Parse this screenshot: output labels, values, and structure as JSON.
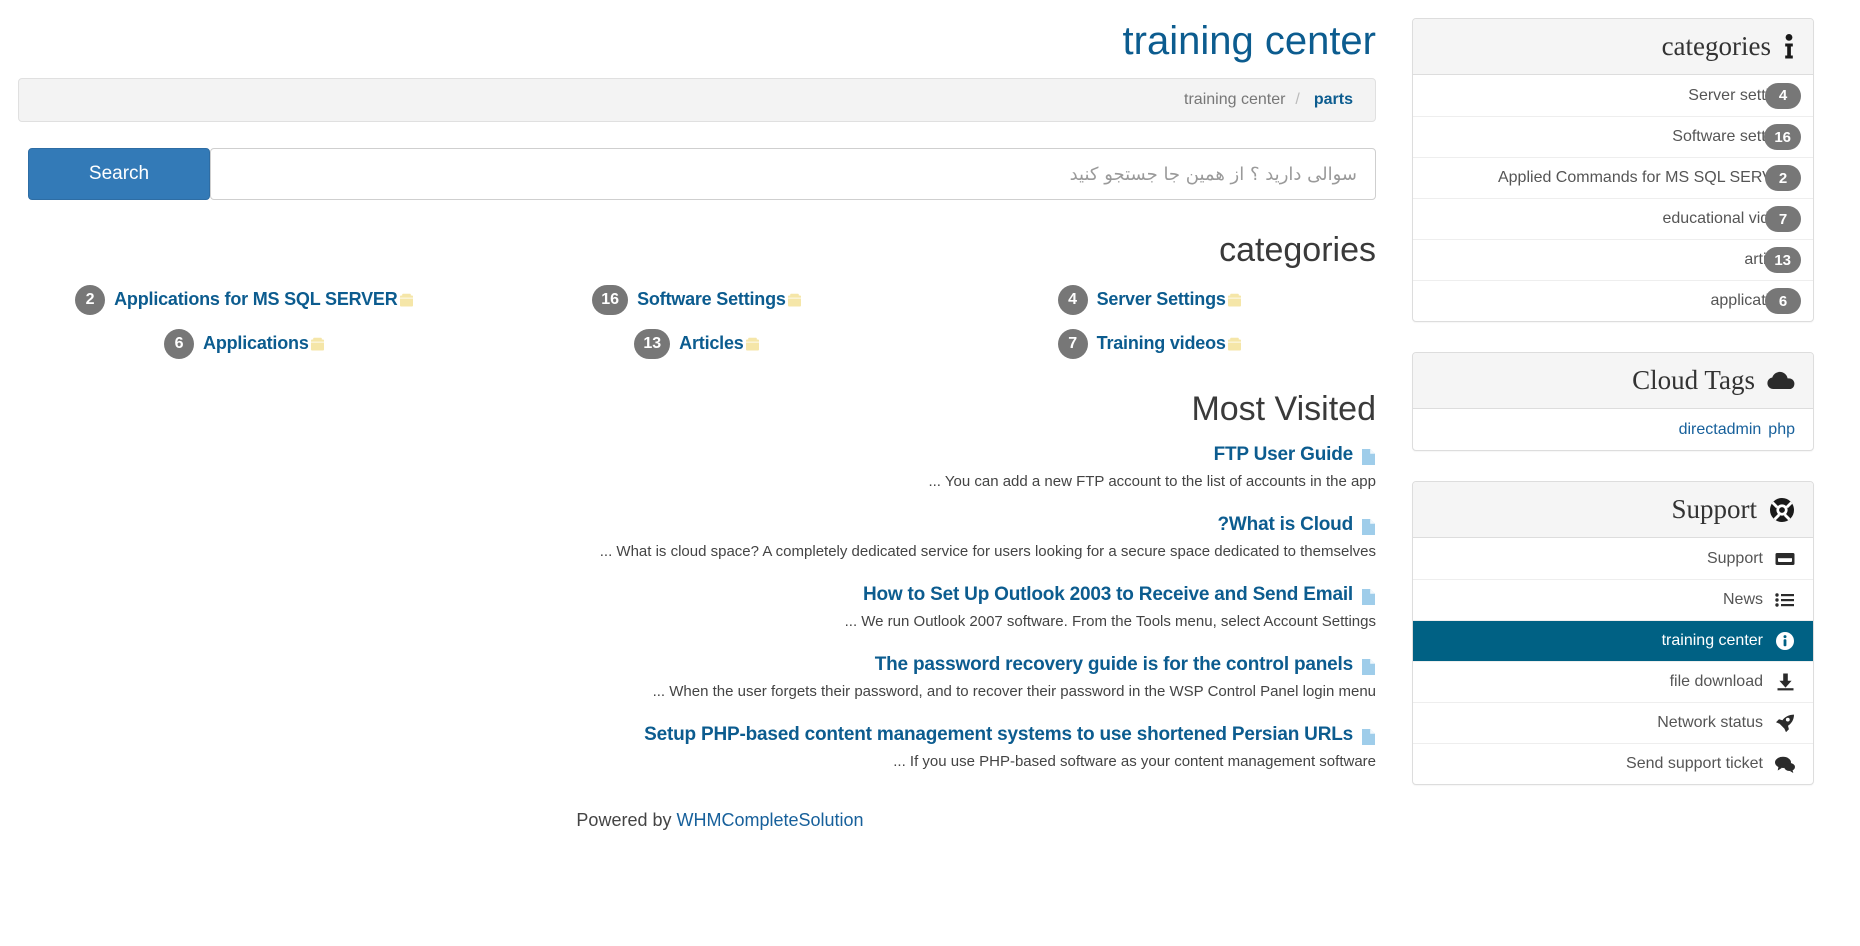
{
  "header": {
    "title": "training center",
    "breadcrumb": {
      "root": "training center",
      "separator": "/",
      "current": "parts"
    }
  },
  "search": {
    "placeholder": "سوالی دارید ؟ از همین جا جستجو کنید",
    "value": "",
    "button_label": "Search"
  },
  "main": {
    "categories_heading": "categories",
    "categories": [
      {
        "count": "2",
        "label": "Applications for MS SQL SERVER",
        "icon": "folder-icon"
      },
      {
        "count": "16",
        "label": "Software Settings",
        "icon": "folder-icon"
      },
      {
        "count": "4",
        "label": "Server Settings",
        "icon": "folder-icon"
      },
      {
        "count": "6",
        "label": "Applications",
        "icon": "folder-icon"
      },
      {
        "count": "13",
        "label": "Articles",
        "icon": "folder-icon"
      },
      {
        "count": "7",
        "label": "Training videos",
        "icon": "folder-icon"
      }
    ],
    "most_visited_heading": "Most Visited",
    "most_visited": [
      {
        "title": "FTP User Guide",
        "snippet": "... You can add a new FTP account to the list of accounts in the app",
        "icon": "document-icon"
      },
      {
        "title": "?What is Cloud",
        "snippet": "... What is cloud space? A completely dedicated service for users looking for a secure space dedicated to themselves",
        "icon": "document-icon"
      },
      {
        "title": "How to Set Up Outlook 2003 to Receive and Send Email",
        "snippet": "... We run Outlook 2007 software. From the Tools menu, select Account Settings",
        "icon": "document-icon"
      },
      {
        "title": "The password recovery guide is for the control panels",
        "snippet": "... When the user forgets their password, and to recover their password in the WSP Control Panel login menu",
        "icon": "document-icon"
      },
      {
        "title": "Setup PHP-based content management systems to use shortened Persian URLs",
        "snippet": "... If you use PHP-based software as your content management software",
        "icon": "document-icon"
      }
    ]
  },
  "footer": {
    "prefix": "Powered by",
    "link_label": "WHMCompleteSolution"
  },
  "sidebar": {
    "categories_panel": {
      "title": "categories",
      "icon": "info-icon",
      "items": [
        {
          "label": "Server settings",
          "count": "4"
        },
        {
          "label": "Software settings",
          "count": "16"
        },
        {
          "label": "Applied Commands for MS SQL SERVER",
          "count": "2"
        },
        {
          "label": "educational videos",
          "count": "7"
        },
        {
          "label": "articles",
          "count": "13"
        },
        {
          "label": "applications",
          "count": "6"
        }
      ]
    },
    "cloud_tags_panel": {
      "title": "Cloud Tags",
      "icon": "cloud-icon",
      "tags": [
        "directadmin",
        "php"
      ]
    },
    "support_panel": {
      "title": "Support",
      "icon": "lifebuoy-icon",
      "items": [
        {
          "label": "Support",
          "icon": "ticket-icon",
          "active": false
        },
        {
          "label": "News",
          "icon": "list-icon",
          "active": false
        },
        {
          "label": "training center",
          "icon": "info-circle-icon",
          "active": true
        },
        {
          "label": "file download",
          "icon": "download-icon",
          "active": false
        },
        {
          "label": "Network status",
          "icon": "rocket-icon",
          "active": false
        },
        {
          "label": "Send support ticket",
          "icon": "comments-icon",
          "active": false
        }
      ]
    }
  },
  "colors": {
    "brand_blue": "#0c5c8f",
    "search_button": "#337ab7",
    "active_row": "#006184",
    "badge_gray": "#777777",
    "folder_yellow": "#f5e6a8",
    "doc_blue": "#9fcdea"
  }
}
